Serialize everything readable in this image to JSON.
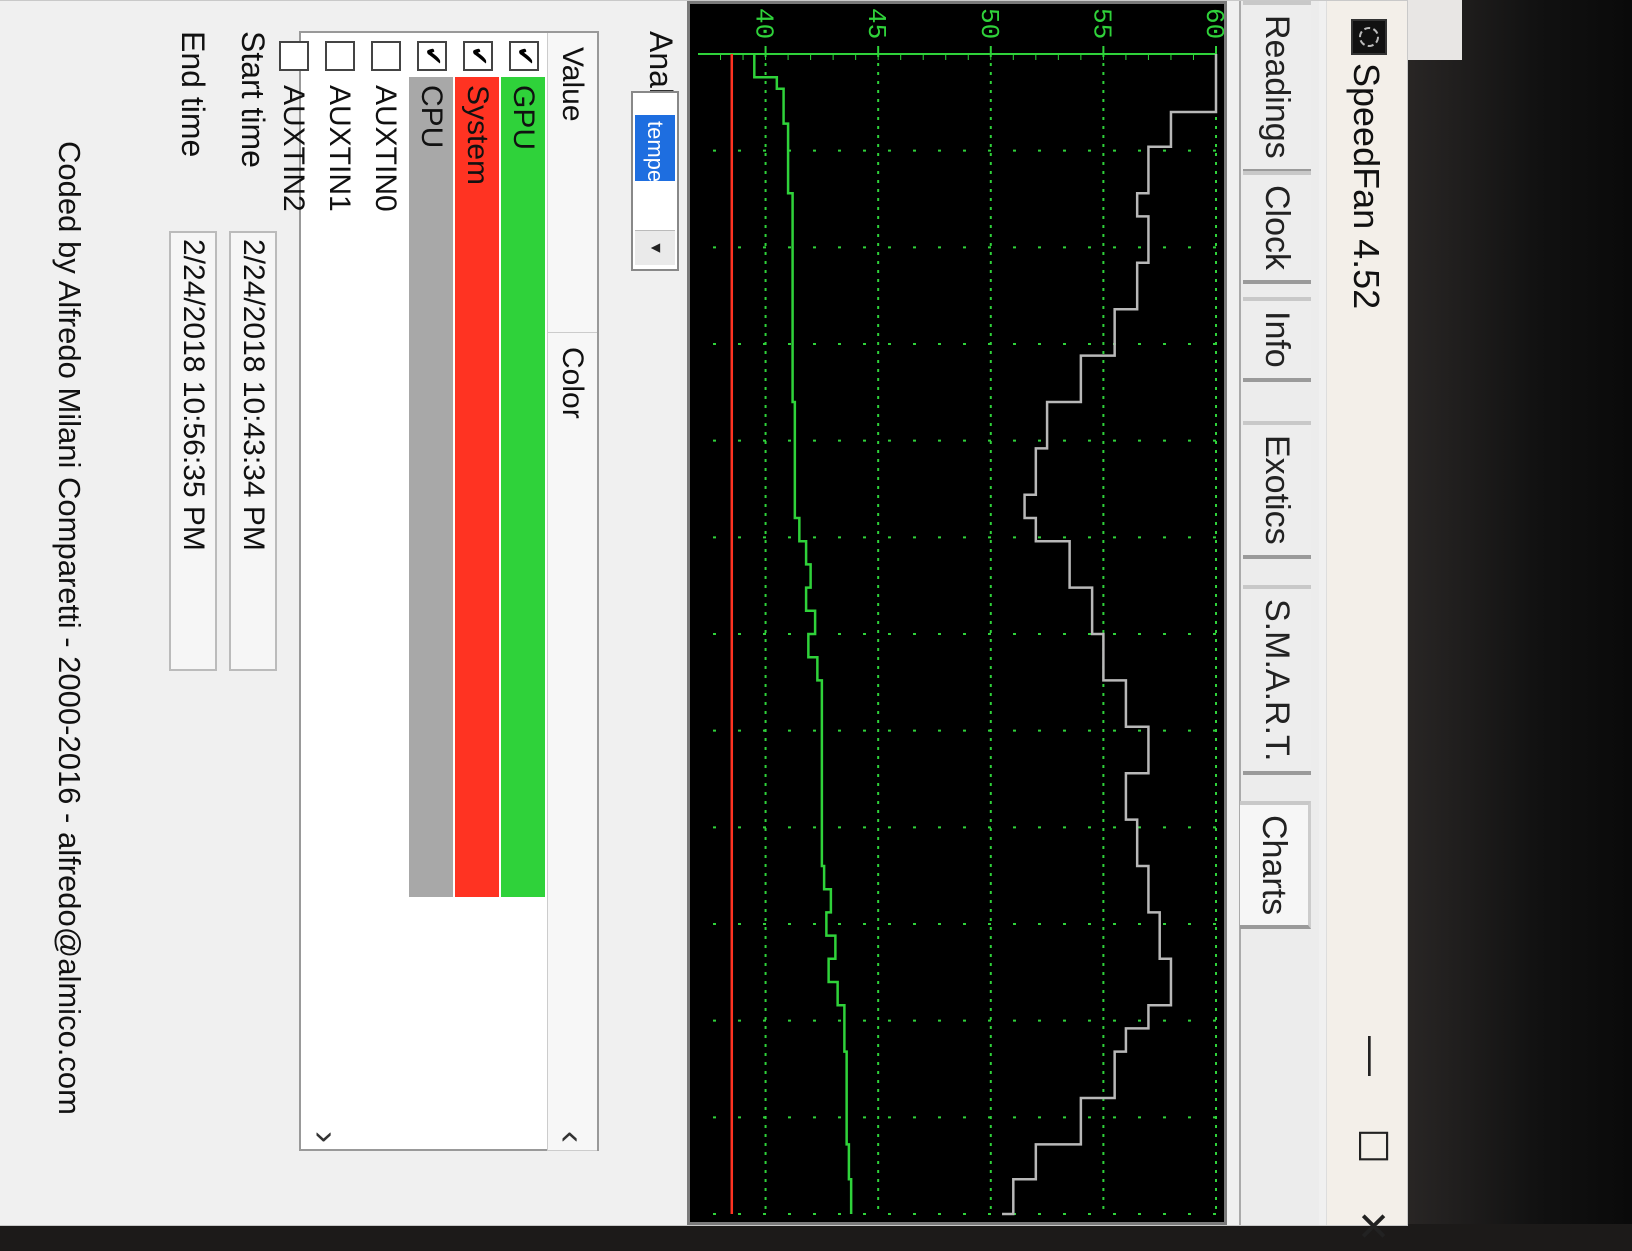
{
  "window": {
    "title": "SpeedFan 4.52",
    "minimize_glyph": "—",
    "maximize_glyph": "☐",
    "close_glyph": "✕"
  },
  "tabs": [
    {
      "label": "Readings"
    },
    {
      "label": "Clock"
    },
    {
      "label": "Info"
    },
    {
      "label": "Exotics"
    },
    {
      "label": "S.M.A.R.T."
    },
    {
      "label": "Charts",
      "active": true
    }
  ],
  "analyze": {
    "label": "Analyze",
    "selected": "temperatures",
    "arrow": "▼"
  },
  "series_list": {
    "col_value": "Value",
    "col_color": "Color",
    "rows": [
      {
        "name": "GPU",
        "checked": true,
        "color": "#2fd23a"
      },
      {
        "name": "System",
        "checked": true,
        "color": "#ff3322"
      },
      {
        "name": "CPU",
        "checked": true,
        "color": "#a8a8a8"
      },
      {
        "name": "AUXTIN0",
        "checked": false,
        "color": ""
      },
      {
        "name": "AUXTIN1",
        "checked": false,
        "color": ""
      },
      {
        "name": "AUXTIN2",
        "checked": false,
        "color": ""
      }
    ],
    "up_arrow": "‹",
    "down_arrow": "›"
  },
  "times": {
    "start_label": "Start time",
    "start_value": "2/24/2018 10:43:34 PM",
    "end_label": "End time",
    "end_value": "2/24/2018 10:56:35 PM"
  },
  "footer": "Coded by Alfredo Milani Comparetti - 2000-2016 - alfredo@almico.com",
  "colors": {
    "chart_bg": "#000000",
    "grid": "#2fd23a",
    "gpu": "#2fd23a",
    "system": "#ff3322",
    "cpu": "#b8b8b8"
  },
  "chart_data": {
    "type": "line",
    "ylim": [
      37,
      60
    ],
    "yticks": [
      "60",
      "55",
      "50",
      "45",
      "40"
    ],
    "xlim": [
      0,
      100
    ],
    "grid": true,
    "series": [
      {
        "name": "CPU",
        "color": "#b8b8b8",
        "x": [
          0,
          5,
          8,
          12,
          14,
          18,
          22,
          26,
          30,
          34,
          38,
          40,
          42,
          46,
          50,
          54,
          58,
          60,
          62,
          66,
          70,
          74,
          78,
          82,
          84,
          86,
          90,
          94,
          97,
          100
        ],
        "y": [
          60,
          58,
          57,
          56.5,
          57,
          56.5,
          55.5,
          54,
          52.5,
          52,
          51.5,
          52,
          53.5,
          54.5,
          55,
          56,
          57,
          57,
          56,
          56.5,
          57,
          57.5,
          58,
          57,
          56,
          55.5,
          54,
          52,
          51,
          50.5
        ]
      },
      {
        "name": "GPU",
        "color": "#2fd23a",
        "x": [
          0,
          2,
          3,
          6,
          10,
          12,
          20,
          30,
          40,
          42,
          44,
          46,
          48,
          50,
          52,
          54,
          60,
          70,
          72,
          74,
          76,
          78,
          80,
          82,
          86,
          90,
          94,
          97,
          100
        ],
        "y": [
          39.5,
          40.5,
          40.8,
          41,
          41,
          41.2,
          41.2,
          41.3,
          41.5,
          41.8,
          42,
          41.8,
          42.2,
          41.9,
          42.3,
          42.5,
          42.5,
          42.6,
          42.9,
          42.7,
          43.1,
          42.8,
          43.2,
          43.5,
          43.6,
          43.6,
          43.7,
          43.8,
          43.8
        ]
      },
      {
        "name": "System",
        "color": "#ff3322",
        "x": [
          0,
          100
        ],
        "y": [
          38.5,
          38.5
        ]
      }
    ]
  }
}
